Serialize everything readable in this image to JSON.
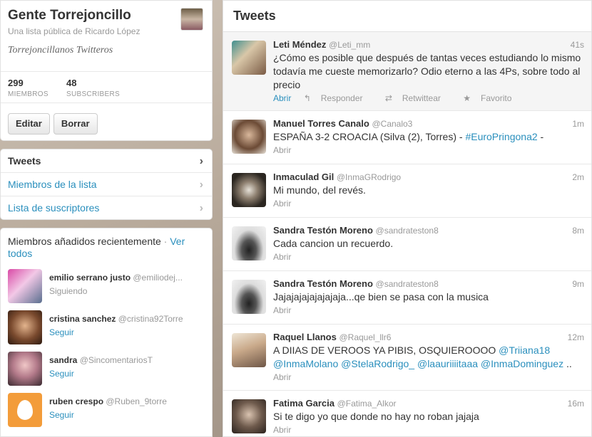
{
  "list": {
    "name": "Gente Torrejoncillo",
    "subtitle": "Una lista pública de Ricardo López",
    "description": "Torrejoncillanos Twitteros",
    "members_count": "299",
    "members_label": "MIEMBROS",
    "subscribers_count": "48",
    "subscribers_label": "SUBSCRIBERS",
    "edit_label": "Editar",
    "delete_label": "Borrar"
  },
  "nav": [
    {
      "label": "Tweets"
    },
    {
      "label": "Miembros de la lista"
    },
    {
      "label": "Lista de suscriptores"
    }
  ],
  "members_panel": {
    "title": "Miembros añadidos recientemente",
    "separator": "·",
    "view_all": "Ver todos",
    "members": [
      {
        "name": "emilio serrano justo",
        "handle": "@emiliodej...",
        "status": "Siguiendo"
      },
      {
        "name": "cristina sanchez",
        "handle": "@cristina92Torre",
        "status": "Seguir"
      },
      {
        "name": "sandra",
        "handle": "@SincomentariosT",
        "status": "Seguir"
      },
      {
        "name": "ruben crespo",
        "handle": "@Ruben_9torre",
        "status": "Seguir"
      }
    ]
  },
  "stream": {
    "title": "Tweets",
    "tweets": [
      {
        "name": "Leti Méndez",
        "handle": "@Leti_mm",
        "time": "41s",
        "text": "¿Cómo es posible que después de tantas veces estudiando lo mismo todavía me cueste memorizarlo? Odio eterno a las 4Ps, sobre todo al precio",
        "open": "Abrir",
        "reply": "Responder",
        "retweet": "Retwittear",
        "favorite": "Favorito"
      },
      {
        "name": "Manuel Torres Canalo",
        "handle": "@Canalo3",
        "time": "1m",
        "text_pre": "ESPAÑA 3-2 CROACIA (Silva (2), Torres) - ",
        "hashtag": "#EuroPringona2",
        "text_post": " -",
        "open": "Abrir"
      },
      {
        "name": "Inmaculad Gil",
        "handle": "@InmaGRodrigo",
        "time": "2m",
        "text": "Mi mundo, del revés.",
        "open": "Abrir"
      },
      {
        "name": "Sandra Testón Moreno",
        "handle": "@sandrateston8",
        "time": "8m",
        "text": "Cada cancion un recuerdo.",
        "open": "Abrir"
      },
      {
        "name": "Sandra Testón Moreno",
        "handle": "@sandrateston8",
        "time": "9m",
        "text": "Jajajajajajajajaja...qe bien se pasa con la musica",
        "open": "Abrir"
      },
      {
        "name": "Raquel Llanos",
        "handle": "@Raquel_llr6",
        "time": "12m",
        "text_pre": "A DIIAS DE VEROOS YA PIBIS, OSQUIEROOOO ",
        "mentions": [
          "@Triiana18",
          "@InmaMolano",
          "@StelaRodrigo_",
          "@laauriiiitaaa",
          "@InmaDominguez"
        ],
        "text_post": " ..",
        "open": "Abrir"
      },
      {
        "name": "Fatima Garcia",
        "handle": "@Fatima_Alkor",
        "time": "16m",
        "text": "Si te digo yo que donde no hay no roban jajaja",
        "open": "Abrir"
      }
    ]
  }
}
